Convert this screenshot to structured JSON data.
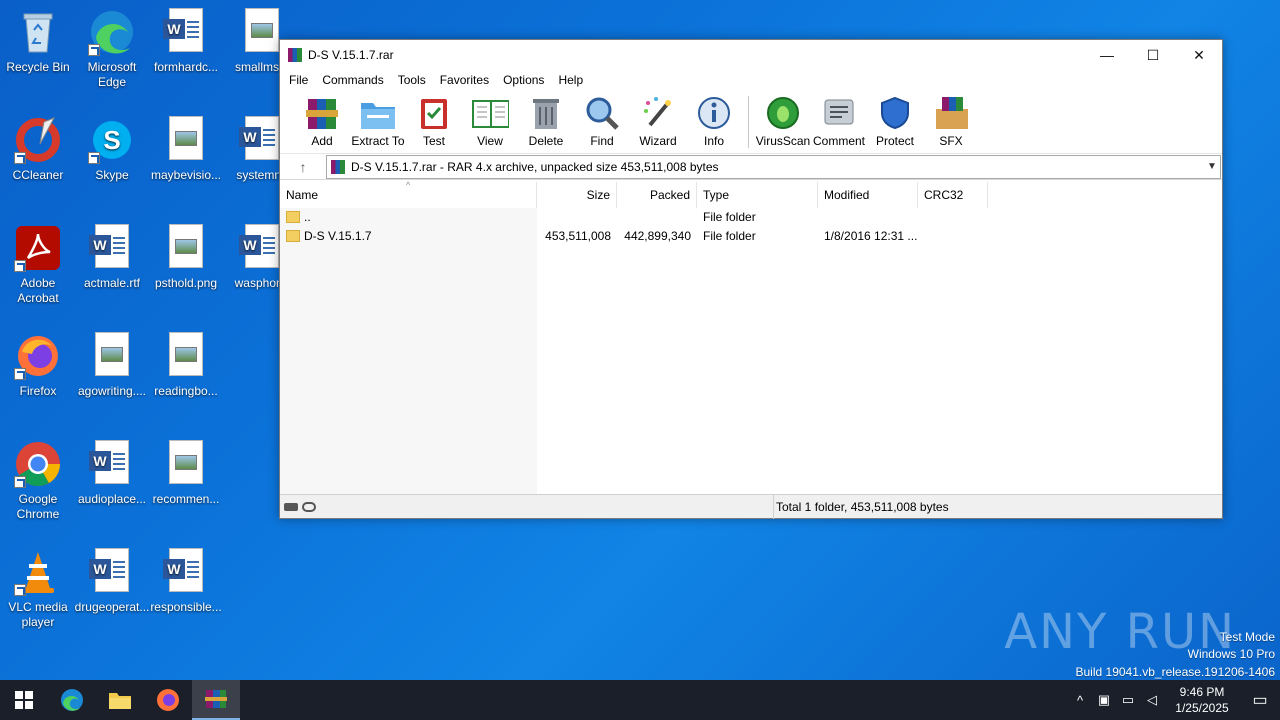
{
  "desktop": {
    "icons": [
      {
        "label": "Recycle Bin"
      },
      {
        "label": "Microsoft Edge"
      },
      {
        "label": "formhardc..."
      },
      {
        "label": "smallms.p"
      },
      {
        "label": "CCleaner"
      },
      {
        "label": "Skype"
      },
      {
        "label": "maybevisio..."
      },
      {
        "label": "systemne"
      },
      {
        "label": "Adobe Acrobat"
      },
      {
        "label": "actmale.rtf"
      },
      {
        "label": "psthold.png"
      },
      {
        "label": "wasphone"
      },
      {
        "label": "Firefox"
      },
      {
        "label": "agowriting...."
      },
      {
        "label": "readingbo..."
      },
      {
        "label": "Google Chrome"
      },
      {
        "label": "audioplace..."
      },
      {
        "label": "recommen..."
      },
      {
        "label": "VLC media player"
      },
      {
        "label": "drugeoperat..."
      },
      {
        "label": "responsible..."
      }
    ]
  },
  "window": {
    "title": "D-S V.15.1.7.rar",
    "controls": {
      "minimize": "—",
      "maximize": "☐",
      "close": "✕"
    },
    "menu": [
      "File",
      "Commands",
      "Tools",
      "Favorites",
      "Options",
      "Help"
    ],
    "toolbar": [
      "Add",
      "Extract To",
      "Test",
      "View",
      "Delete",
      "Find",
      "Wizard",
      "Info",
      "VirusScan",
      "Comment",
      "Protect",
      "SFX"
    ],
    "address": "D-S V.15.1.7.rar - RAR 4.x archive, unpacked size 453,511,008 bytes",
    "columns": {
      "name": "Name",
      "size": "Size",
      "packed": "Packed",
      "type": "Type",
      "modified": "Modified",
      "crc": "CRC32"
    },
    "rows": [
      {
        "name": "..",
        "size": "",
        "packed": "",
        "type": "File folder",
        "modified": ""
      },
      {
        "name": "D-S V.15.1.7",
        "size": "453,511,008",
        "packed": "442,899,340",
        "type": "File folder",
        "modified": "1/8/2016 12:31 ..."
      }
    ],
    "status": "Total 1 folder, 453,511,008 bytes"
  },
  "watermark": {
    "text": "ANY RUN"
  },
  "sysinfo": {
    "line1": "Test Mode",
    "line2": "Windows 10 Pro",
    "line3": "Build 19041.vb_release.191206-1406"
  },
  "taskbar": {
    "time": "9:46 PM",
    "date": "1/25/2025"
  }
}
